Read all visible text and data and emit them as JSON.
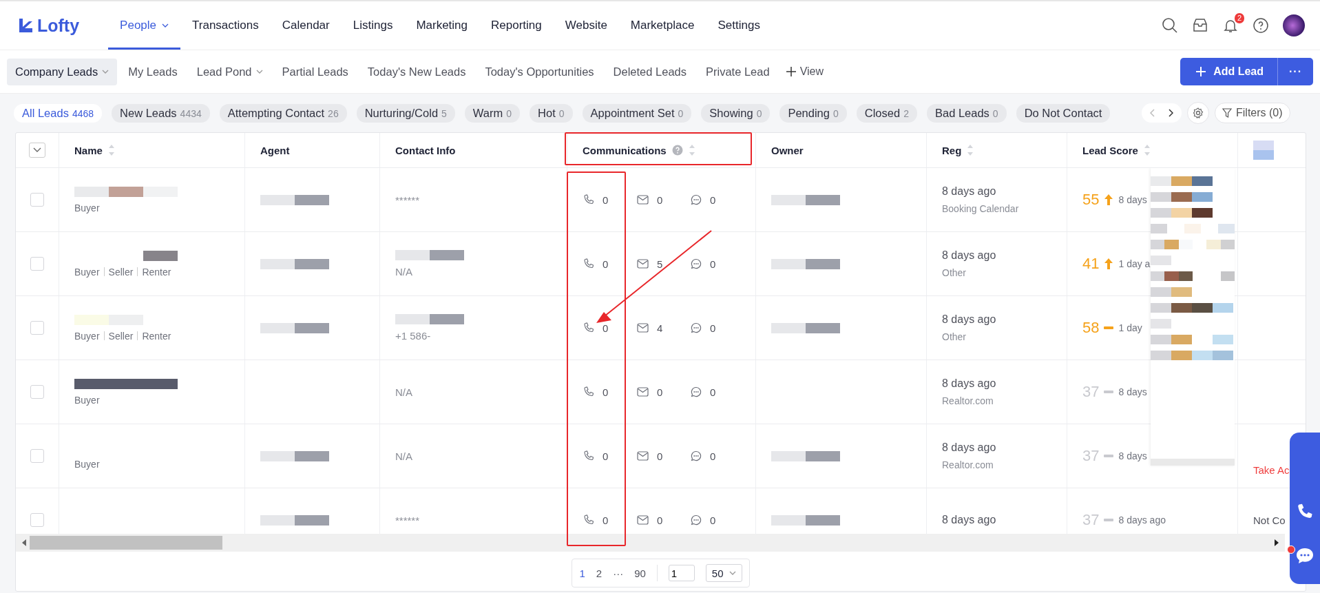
{
  "logo": {
    "text": "Lofty"
  },
  "nav": [
    {
      "label": "People",
      "selected": true,
      "caret": true
    },
    {
      "label": "Transactions",
      "selected": false,
      "caret": false
    },
    {
      "label": "Calendar",
      "selected": false,
      "caret": false
    },
    {
      "label": "Listings",
      "selected": false,
      "caret": false
    },
    {
      "label": "Marketing",
      "selected": false,
      "caret": false
    },
    {
      "label": "Reporting",
      "selected": false,
      "caret": false
    },
    {
      "label": "Website",
      "selected": false,
      "caret": false
    },
    {
      "label": "Marketplace",
      "selected": false,
      "caret": false
    },
    {
      "label": "Settings",
      "selected": false,
      "caret": false
    }
  ],
  "notifications": {
    "badge": "2"
  },
  "tabs": [
    {
      "label": "Company Leads",
      "selected": true,
      "caret": true
    },
    {
      "label": "My Leads",
      "selected": false,
      "caret": false
    },
    {
      "label": "Lead Pond",
      "selected": false,
      "caret": true
    },
    {
      "label": "Partial Leads",
      "selected": false,
      "caret": false
    },
    {
      "label": "Today's New Leads",
      "selected": false,
      "caret": false
    },
    {
      "label": "Today's Opportunities",
      "selected": false,
      "caret": false
    },
    {
      "label": "Deleted Leads",
      "selected": false,
      "caret": false
    },
    {
      "label": "Private Lead",
      "selected": false,
      "caret": false
    }
  ],
  "view_button": {
    "label": "View"
  },
  "add_button": {
    "label": "Add Lead",
    "more": "···"
  },
  "filters": [
    {
      "label": "All Leads",
      "count": "4468",
      "selected": true
    },
    {
      "label": "New Leads",
      "count": "4434",
      "selected": false
    },
    {
      "label": "Attempting Contact",
      "count": "26",
      "selected": false
    },
    {
      "label": "Nurturing/Cold",
      "count": "5",
      "selected": false
    },
    {
      "label": "Warm",
      "count": "0",
      "selected": false
    },
    {
      "label": "Hot",
      "count": "0",
      "selected": false
    },
    {
      "label": "Appointment Set",
      "count": "0",
      "selected": false
    },
    {
      "label": "Showing",
      "count": "0",
      "selected": false
    },
    {
      "label": "Pending",
      "count": "0",
      "selected": false
    },
    {
      "label": "Closed",
      "count": "2",
      "selected": false
    },
    {
      "label": "Bad Leads",
      "count": "0",
      "selected": false
    },
    {
      "label": "Do Not Contact",
      "selected": false
    }
  ],
  "filter_button": {
    "label": "Filters (0)"
  },
  "table": {
    "columns": [
      {
        "label": "Name",
        "sortable": true
      },
      {
        "label": "Agent"
      },
      {
        "label": "Contact Info"
      },
      {
        "label": "Communications",
        "sortable": true,
        "help": true
      },
      {
        "label": "Owner"
      },
      {
        "label": "Reg",
        "sortable": true
      },
      {
        "label": "Lead Score",
        "sortable": true
      }
    ],
    "rows": [
      {
        "checked": false,
        "tags": [
          "Buyer"
        ],
        "contact": "******",
        "calls": "0",
        "emails": "0",
        "texts": "0",
        "reg": "8 days ago",
        "source": "Booking Calendar",
        "score": "55",
        "color": "#f5a21b",
        "rising": true,
        "last": "8 days"
      },
      {
        "checked": false,
        "tags": [
          "Buyer",
          "Seller",
          "Renter"
        ],
        "contact": "N/A",
        "calls": "0",
        "emails": "5",
        "texts": "0",
        "reg": "8 days ago",
        "source": "Other",
        "score": "41",
        "color": "#f5a21b",
        "rising": true,
        "last": "1 day a"
      },
      {
        "checked": false,
        "tags": [
          "Buyer",
          "Seller",
          "Renter"
        ],
        "contact": "+1 586-",
        "calls": "0",
        "emails": "4",
        "texts": "0",
        "reg": "8 days ago",
        "source": "Other",
        "score": "58",
        "color": "#f5a21b",
        "rising": false,
        "last": "1 day"
      },
      {
        "checked": false,
        "tags": [
          "Buyer"
        ],
        "contact": "N/A",
        "calls": "0",
        "emails": "0",
        "texts": "0",
        "reg": "8 days ago",
        "source": "Realtor.com",
        "score": "37",
        "color": "#c9cacf",
        "rising": false,
        "last": "8 days"
      },
      {
        "checked": false,
        "tags": [
          "Buyer"
        ],
        "contact": "N/A",
        "calls": "0",
        "emails": "0",
        "texts": "0",
        "reg": "8 days ago",
        "source": "Realtor.com",
        "score": "37",
        "color": "#c9cacf",
        "rising": false,
        "last": "8 days",
        "column_9": "Take Ac",
        "column_9_alert": true
      },
      {
        "checked": false,
        "tags": [],
        "contact": "******",
        "calls": "0",
        "emails": "0",
        "texts": "0",
        "reg": "8 days ago",
        "score": "37",
        "color": "#c9cacf",
        "rising": false,
        "last": "8 days ago",
        "column_9": "Not Co",
        "column_9_alert": false
      }
    ]
  },
  "pagination": {
    "pages": [
      {
        "label": "1",
        "selected": true
      },
      {
        "label": "2",
        "selected": false
      },
      {
        "label": "···",
        "selected": false
      },
      {
        "label": "90",
        "selected": false
      }
    ],
    "jump": "1",
    "page_size": "50"
  }
}
